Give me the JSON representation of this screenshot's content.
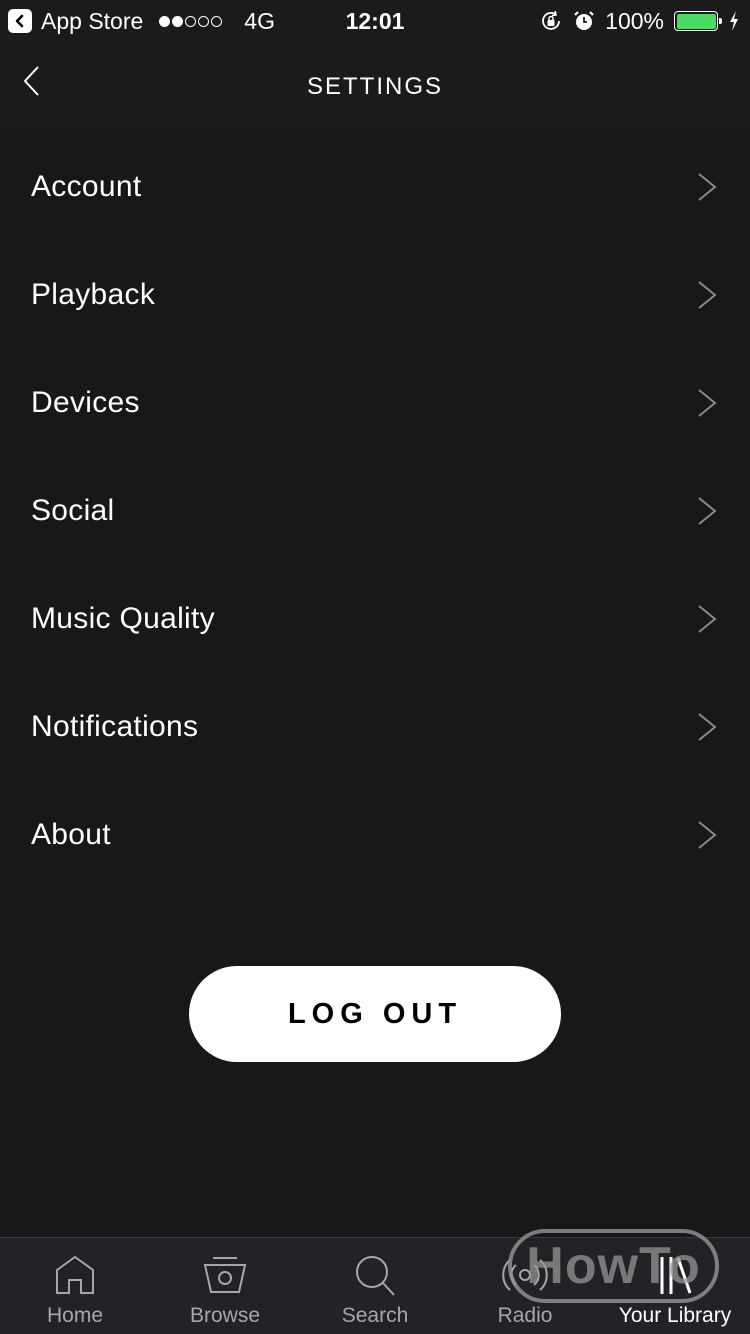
{
  "status_bar": {
    "back_app": "App Store",
    "signal_bars_filled": 2,
    "signal_bars_total": 5,
    "network": "4G",
    "time": "12:01",
    "battery_percent_label": "100%",
    "battery_level": 1.0,
    "battery_color": "#4cd964",
    "icons": [
      "orientation-lock-icon",
      "alarm-icon",
      "charging-bolt-icon"
    ]
  },
  "nav": {
    "title": "SETTINGS",
    "back_icon": "chevron-left-icon"
  },
  "settings": {
    "items": [
      {
        "label": "Account"
      },
      {
        "label": "Playback"
      },
      {
        "label": "Devices"
      },
      {
        "label": "Social"
      },
      {
        "label": "Music Quality"
      },
      {
        "label": "Notifications"
      },
      {
        "label": "About"
      }
    ]
  },
  "logout": {
    "label": "LOG OUT"
  },
  "tab_bar": {
    "tabs": [
      {
        "label": "Home",
        "icon": "home-icon",
        "active": false
      },
      {
        "label": "Browse",
        "icon": "browse-icon",
        "active": false
      },
      {
        "label": "Search",
        "icon": "search-icon",
        "active": false
      },
      {
        "label": "Radio",
        "icon": "radio-icon",
        "active": false
      },
      {
        "label": "Your Library",
        "icon": "library-icon",
        "active": true
      }
    ]
  },
  "watermark": {
    "text": "HowTo"
  }
}
